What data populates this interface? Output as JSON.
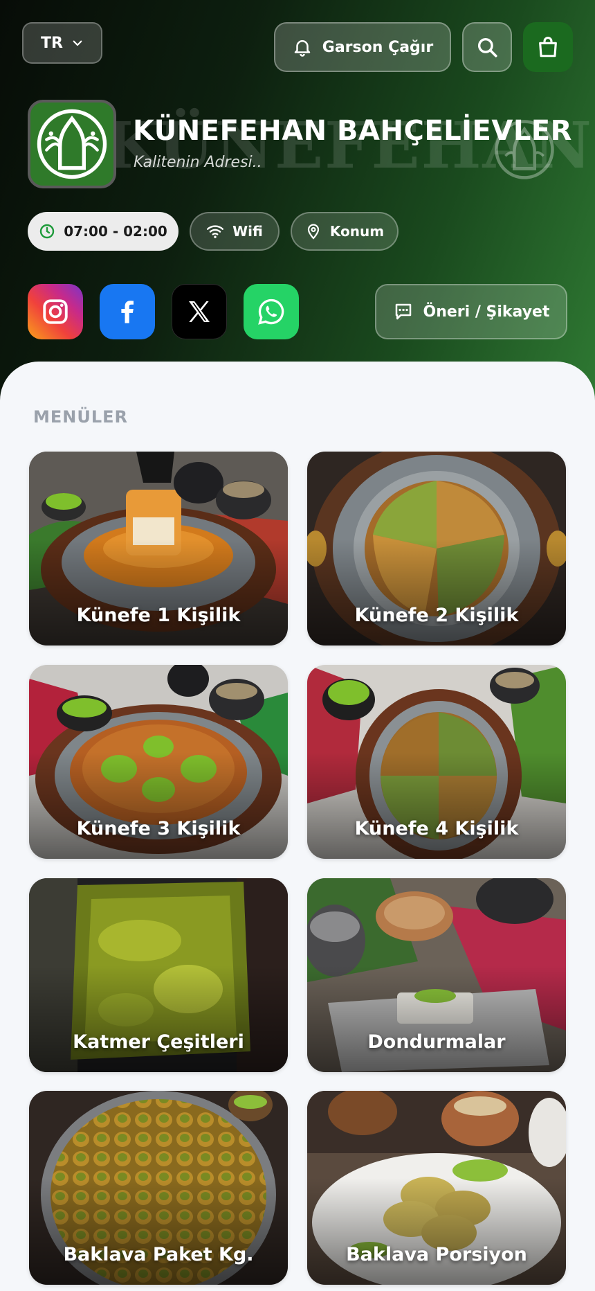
{
  "header": {
    "language": "TR",
    "waiter_call_label": "Garson Çağır",
    "brand_name": "KÜNEFEHAN BAHÇELİEVLER",
    "slogan": "Kalitenin Adresi..",
    "watermark_text": "KÜNEFEHAN",
    "hours": "07:00 - 02:00",
    "wifi_label": "Wifi",
    "location_label": "Konum",
    "feedback_label": "Öneri / Şikayet",
    "social": [
      "instagram-icon",
      "facebook-icon",
      "x-icon",
      "whatsapp-icon"
    ]
  },
  "menus": {
    "section_title": "MENÜLER",
    "items": [
      {
        "label": "Künefe 1 Kişilik"
      },
      {
        "label": "Künefe 2 Kişilik"
      },
      {
        "label": "Künefe 3 Kişilik"
      },
      {
        "label": "Künefe 4 Kişilik"
      },
      {
        "label": "Katmer Çeşitleri"
      },
      {
        "label": "Dondurmalar"
      },
      {
        "label": "Baklava Paket Kg."
      },
      {
        "label": "Baklava Porsiyon"
      }
    ]
  },
  "colors": {
    "brand_green": "#1b6a1f",
    "logo_green": "#2f7a2a",
    "background": "#f5f7fa",
    "section_title": "#9aa1ab"
  }
}
